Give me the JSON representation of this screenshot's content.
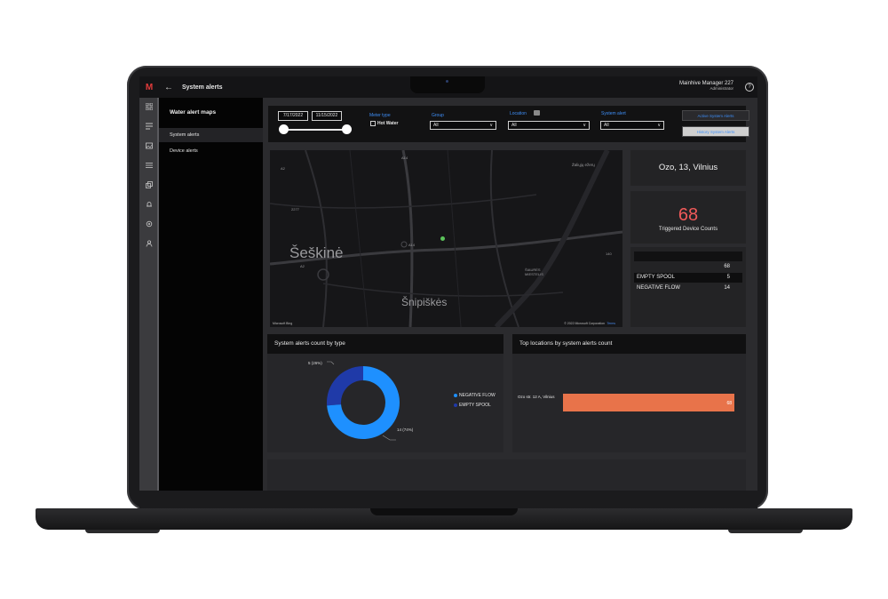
{
  "app": {
    "logo_glyph": "M",
    "page_title": "System alerts",
    "user_name": "Mainhive Manager 227",
    "user_role": "Administrator",
    "help_glyph": "?",
    "accent_color": "#3e8ef7",
    "alert_color": "#f05a5a"
  },
  "rail": {
    "icons": [
      "grid-icon",
      "alerts-list-icon",
      "image-icon",
      "list-icon",
      "layers-icon",
      "bell-icon",
      "gear-icon",
      "user-icon"
    ]
  },
  "nav": {
    "title": "Water alert maps",
    "items": [
      {
        "label": "System alerts",
        "selected": true
      },
      {
        "label": "Device alerts",
        "selected": false
      }
    ]
  },
  "filters": {
    "date_from": "7/17/2022",
    "date_to": "11/15/2022",
    "meter_type_label": "Meter type",
    "hot_water_label": "Hot Water",
    "group_label": "Group",
    "group_value": "All",
    "location_label": "Location",
    "location_value": "All",
    "system_alert_label": "System alert",
    "system_alert_value": "All",
    "btn_active": "Active System Alerts",
    "btn_history": "History System Alerts"
  },
  "map": {
    "district_1": "Šeškinė",
    "district_2": "Šnipiškės",
    "district_3": "Žaliųjų ežerų",
    "district_4": "ŠIAURĖS MIESTELIS",
    "road_labels": [
      "A2",
      "A14",
      "2277",
      "A14",
      "A2",
      "140"
    ],
    "attribution_left": "Microsoft Bing",
    "attribution_right": "© 2022 Microsoft Corporation",
    "terms": "Terms"
  },
  "location_card": {
    "address": "Ozo, 13, Vilnius"
  },
  "kpi": {
    "value": "68",
    "label": "Triggered Device Counts"
  },
  "alert_table": {
    "rows": [
      {
        "name": "",
        "value": "68"
      },
      {
        "name": "EMPTY SPOOL",
        "value": "5"
      },
      {
        "name": "NEGATIVE FLOW",
        "value": "14"
      }
    ]
  },
  "donut_panel": {
    "title": "System alerts count by type",
    "chart_data": {
      "type": "pie",
      "categories": [
        "NEGATIVE FLOW",
        "EMPTY SPOOL"
      ],
      "values": [
        14,
        5
      ],
      "percents": [
        74,
        26
      ],
      "data_labels": [
        "14 (74%)",
        "5 (26%)"
      ],
      "colors": [
        "#1e90ff",
        "#1f3aa8"
      ],
      "legend_position": "right"
    }
  },
  "bar_panel": {
    "title": "Top locations by system alerts count",
    "chart_data": {
      "type": "bar",
      "orientation": "horizontal",
      "categories": [
        "Ozo str. 12 A, Vilnius"
      ],
      "values": [
        68
      ],
      "xlim": [
        0,
        68
      ],
      "color": "#e8734a",
      "data_labels": [
        "68"
      ]
    }
  }
}
